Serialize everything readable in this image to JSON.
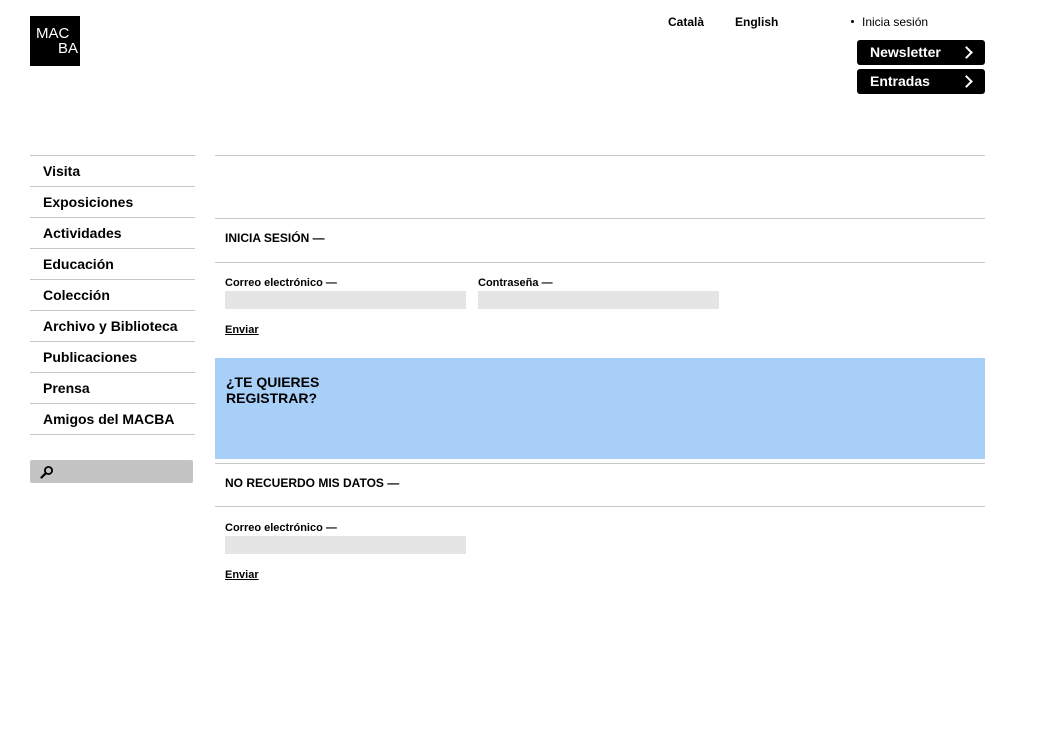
{
  "logo": {
    "line1": "MAC",
    "line2": "BA"
  },
  "header": {
    "lang_ca": "Català",
    "lang_en": "English",
    "login_link": "Inicia sesión",
    "newsletter_label": "Newsletter",
    "tickets_label": "Entradas"
  },
  "nav": {
    "items": [
      {
        "label": "Visita"
      },
      {
        "label": "Exposiciones"
      },
      {
        "label": "Actividades"
      },
      {
        "label": "Educación"
      },
      {
        "label": "Colección"
      },
      {
        "label": "Archivo y Biblioteca"
      },
      {
        "label": "Publicaciones"
      },
      {
        "label": "Prensa"
      },
      {
        "label": "Amigos del MACBA"
      }
    ]
  },
  "search": {
    "icon": "search-icon",
    "value": ""
  },
  "login": {
    "title": "INICIA SESIÓN —",
    "email_label": "Correo electrónico —",
    "email_value": "",
    "password_label": "Contraseña —",
    "password_value": "",
    "submit_label": "Enviar"
  },
  "register": {
    "title": "¿TE QUIERES REGISTRAR?",
    "bg_color": "#a8cff8"
  },
  "recover": {
    "title": "NO RECUERDO MIS DATOS —",
    "email_label": "Correo electrónico —",
    "email_value": "",
    "submit_label": "Enviar"
  }
}
